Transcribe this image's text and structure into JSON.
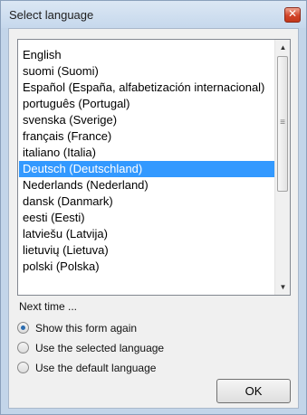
{
  "window": {
    "title": "Select language",
    "close_glyph": "✕"
  },
  "languages": {
    "items": [
      "English",
      "suomi (Suomi)",
      "Español (España, alfabetización internacional)",
      "português (Portugal)",
      "svenska (Sverige)",
      "français (France)",
      "italiano (Italia)",
      "Deutsch (Deutschland)",
      "Nederlands (Nederland)",
      "dansk (Danmark)",
      "eesti (Eesti)",
      "latviešu (Latvija)",
      "lietuvių (Lietuva)",
      "polski (Polska)"
    ],
    "selected_index": 7
  },
  "next_time": {
    "label": "Next time ...",
    "options": [
      {
        "label": "Show this form again",
        "checked": true
      },
      {
        "label": "Use the selected language",
        "checked": false
      },
      {
        "label": "Use the default language",
        "checked": false
      }
    ]
  },
  "ok_button": {
    "label": "OK"
  }
}
